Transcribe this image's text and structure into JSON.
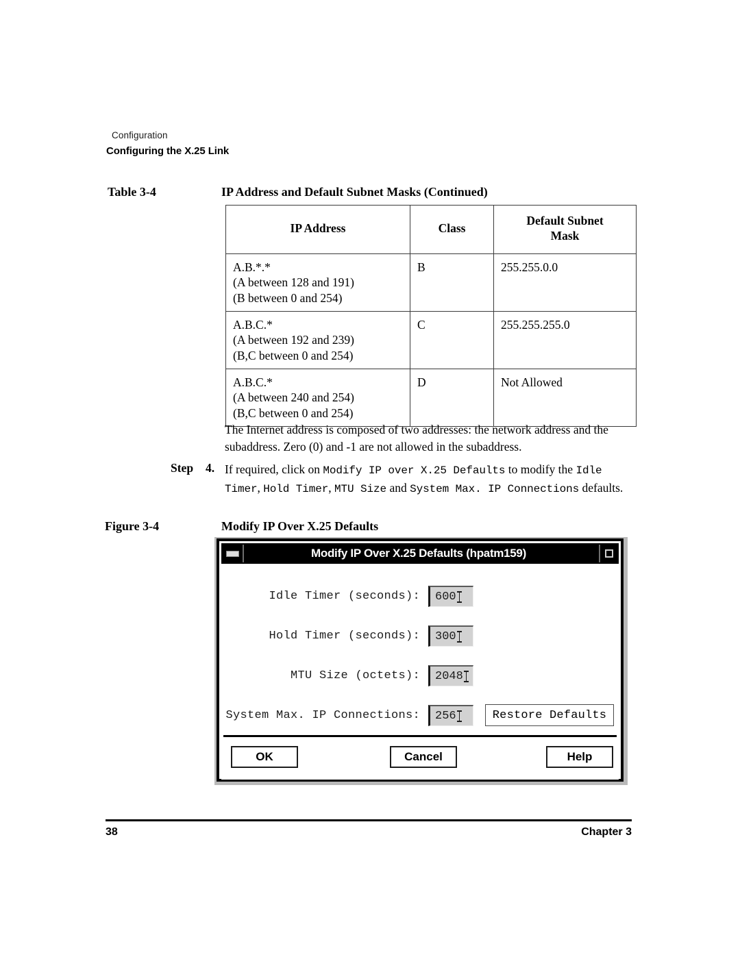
{
  "running_header": {
    "chapter_name": "Configuration",
    "section_name": "Configuring the X.25 Link"
  },
  "table_caption": {
    "number": "Table 3-4",
    "title": "IP Address and Default Subnet Masks (Continued)"
  },
  "ip_table": {
    "headers": [
      "IP Address",
      "Class",
      "Default Subnet Mask"
    ],
    "header_mask_line1": "Default Subnet",
    "header_mask_line2": "Mask",
    "rows": [
      {
        "ip_line1": "A.B.*.*",
        "ip_line2": "(A between 128 and 191)",
        "ip_line3": "(B between 0 and 254)",
        "class": "B",
        "mask": "255.255.0.0"
      },
      {
        "ip_line1": "A.B.C.*",
        "ip_line2": "(A between 192 and 239)",
        "ip_line3": "(B,C between 0 and 254)",
        "class": "C",
        "mask": "255.255.255.0"
      },
      {
        "ip_line1": "A.B.C.*",
        "ip_line2": "(A between 240 and 254)",
        "ip_line3": "(B,C between 0 and 254)",
        "class": "D",
        "mask": "Not Allowed"
      }
    ]
  },
  "paragraph": {
    "text": "The Internet address is composed of two addresses: the network address and the subaddress. Zero (0) and -1 are not allowed in the subaddress."
  },
  "step": {
    "label": "Step",
    "number": "4.",
    "part1": "If required, click on ",
    "mono1": "Modify IP over X.25 Defaults",
    "part2": " to modify the ",
    "mono2": "Idle Timer",
    "part3": ", ",
    "mono3": "Hold Timer",
    "part4": ", ",
    "mono4": "MTU Size",
    "part5": " and ",
    "mono5": "System Max. IP Connections",
    "part6": " defaults."
  },
  "figure_caption": {
    "number": "Figure 3-4",
    "title": "Modify IP Over X.25 Defaults"
  },
  "dialog": {
    "title": "Modify IP Over X.25 Defaults (hpatm159)",
    "minimize_icon": "minimize-icon",
    "maximize_icon": "maximize-icon",
    "fields": [
      {
        "label": "Idle Timer (seconds):",
        "value": "600"
      },
      {
        "label": "Hold Timer (seconds):",
        "value": "300"
      },
      {
        "label": "MTU Size (octets):",
        "value": "2048"
      },
      {
        "label": "System Max. IP Connections:",
        "value": "256"
      }
    ],
    "restore_button": "Restore Defaults",
    "ok_button": "OK",
    "cancel_button": "Cancel",
    "help_button": "Help"
  },
  "footer": {
    "page_number": "38",
    "chapter": "Chapter 3"
  },
  "colors": {
    "titlebar_bg": "#000000",
    "titlebar_text": "#ffffff",
    "field_bg": "#d2d2d2",
    "dialog_bg": "#ffffff",
    "page_bg": "#ffffff",
    "text": "#000000"
  }
}
